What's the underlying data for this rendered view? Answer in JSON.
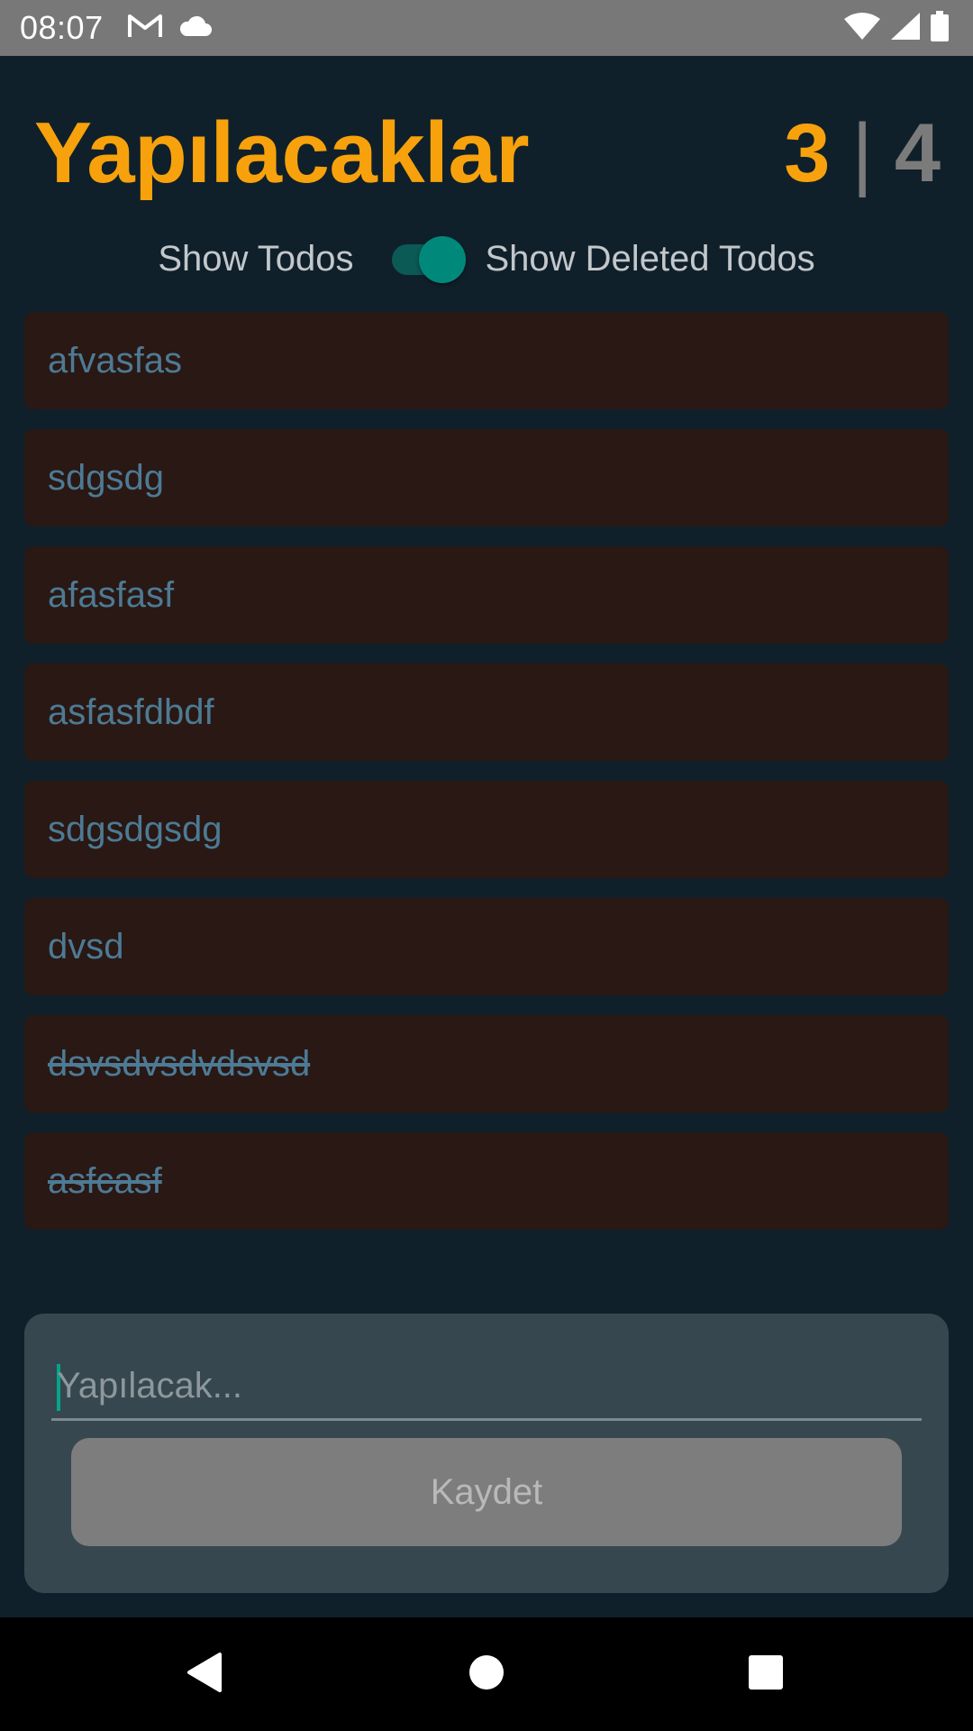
{
  "status_bar": {
    "time": "08:07",
    "left_icons": [
      "gmail-icon",
      "cloud-icon"
    ],
    "right_icons": [
      "wifi-icon",
      "signal-icon",
      "battery-icon"
    ]
  },
  "header": {
    "title": "Yapılacaklar",
    "active_count": "3",
    "separator": "|",
    "total_count": "4"
  },
  "toggle": {
    "left_label": "Show Todos",
    "right_label": "Show Deleted Todos",
    "checked": true
  },
  "todos": [
    {
      "text": "afvasfas",
      "deleted": false
    },
    {
      "text": "sdgsdg",
      "deleted": false
    },
    {
      "text": "afasfasf",
      "deleted": false
    },
    {
      "text": "asfasfdbdf",
      "deleted": false
    },
    {
      "text": "sdgsdgsdg",
      "deleted": false
    },
    {
      "text": "dvsd",
      "deleted": false
    },
    {
      "text": "dsvsdvsdvdsvsd",
      "deleted": true
    },
    {
      "text": "asfcasf",
      "deleted": true
    }
  ],
  "form": {
    "placeholder": "Yapılacak...",
    "value": "",
    "save_label": "Kaydet"
  },
  "nav": {
    "icons": [
      "back-icon",
      "home-icon",
      "recents-icon"
    ]
  },
  "colors": {
    "background": "#10202a",
    "accent": "#f7a20c",
    "item_background": "#291814",
    "item_text": "#4d7a94",
    "switch": "#00897b"
  }
}
